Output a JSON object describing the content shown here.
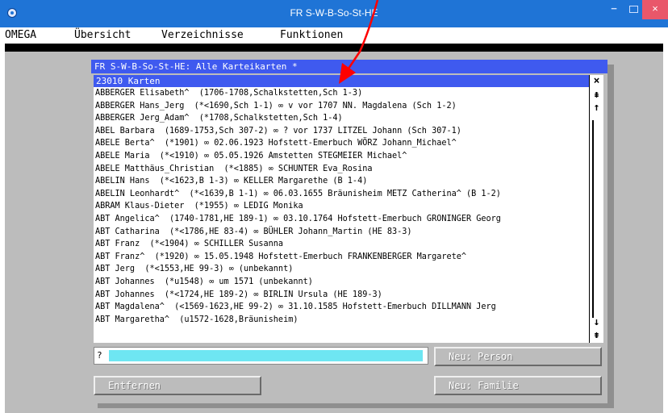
{
  "window": {
    "title": "FR S-W-B-So-St-HE",
    "minimize_glyph": "−",
    "close_glyph": "×"
  },
  "menu": {
    "items": [
      "OMEGA",
      "Übersicht",
      "Verzeichnisse",
      "Funktionen"
    ]
  },
  "dialog": {
    "title": "FR S-W-B-So-St-HE: Alle Karteikarten *",
    "count": "23010 Karten",
    "close_glyph": "×",
    "scroll_glyphs": {
      "page_up": "⇞",
      "up": "↑",
      "down": "↓",
      "page_down": "⇟"
    },
    "entries": [
      "ABBERGER Elisabeth^  (1706-1708,Schalkstetten,Sch 1-3)",
      "ABBERGER Hans_Jerg  (*<1690,Sch 1-1) ∞ v vor 1707 NN. Magdalena (Sch 1-2)",
      "ABBERGER Jerg_Adam^  (*1708,Schalkstetten,Sch 1-4)",
      "ABEL Barbara  (1689-1753,Sch 307-2) ∞ ? vor 1737 LITZEL Johann (Sch 307-1)",
      "ABELE Berta^  (*1901) ∞ 02.06.1923 Hofstett-Emerbuch WÖRZ Johann_Michael^",
      "ABELE Maria  (*<1910) ∞ 05.05.1926 Amstetten STEGMEIER Michael^",
      "ABELE Matthäus_Christian  (*<1885) ∞ SCHUNTER Eva_Rosina",
      "ABELIN Hans  (*<1623,B 1-3) ∞ KELLER Margarethe (B 1-4)",
      "ABELIN Leonhardt^  (*<1639,B 1-1) ∞ 06.03.1655 Bräunisheim METZ Catherina^ (B 1-2)",
      "ABRAM Klaus-Dieter  (*1955) ∞ LEDIG Monika",
      "ABT Angelica^  (1740-1781,HE 189-1) ∞ 03.10.1764 Hofstett-Emerbuch GRONINGER Georg",
      "ABT Catharina  (*<1786,HE 83-4) ∞ BÜHLER Johann_Martin (HE 83-3)",
      "ABT Franz  (*<1904) ∞ SCHILLER Susanna",
      "ABT Franz^  (*1920) ∞ 15.05.1948 Hofstett-Emerbuch FRANKENBERGER Margarete^",
      "ABT Jerg  (*<1553,HE 99-3) ∞ (unbekannt)",
      "ABT Johannes  (*u1548) ∞ um 1571 (unbekannt)",
      "ABT Johannes  (*<1724,HE 189-2) ∞ BIRLIN Ursula (HE 189-3)",
      "ABT Magdalena^  (<1569-1623,HE 99-2) ∞ 31.10.1585 Hofstett-Emerbuch DILLMANN Jerg",
      "ABT Margaretha^  (u1572-1628,Bräunisheim)"
    ],
    "search": {
      "prompt": "?",
      "value": ""
    },
    "buttons": {
      "new_person": "Neu: Person",
      "new_family": "Neu: Familie",
      "remove": "Entfernen"
    }
  },
  "colors": {
    "titlebar": "#1f74d6",
    "dialog_blue": "#3f5aef",
    "input_cyan": "#6ee6f2",
    "annotation_red": "#ff0000"
  }
}
